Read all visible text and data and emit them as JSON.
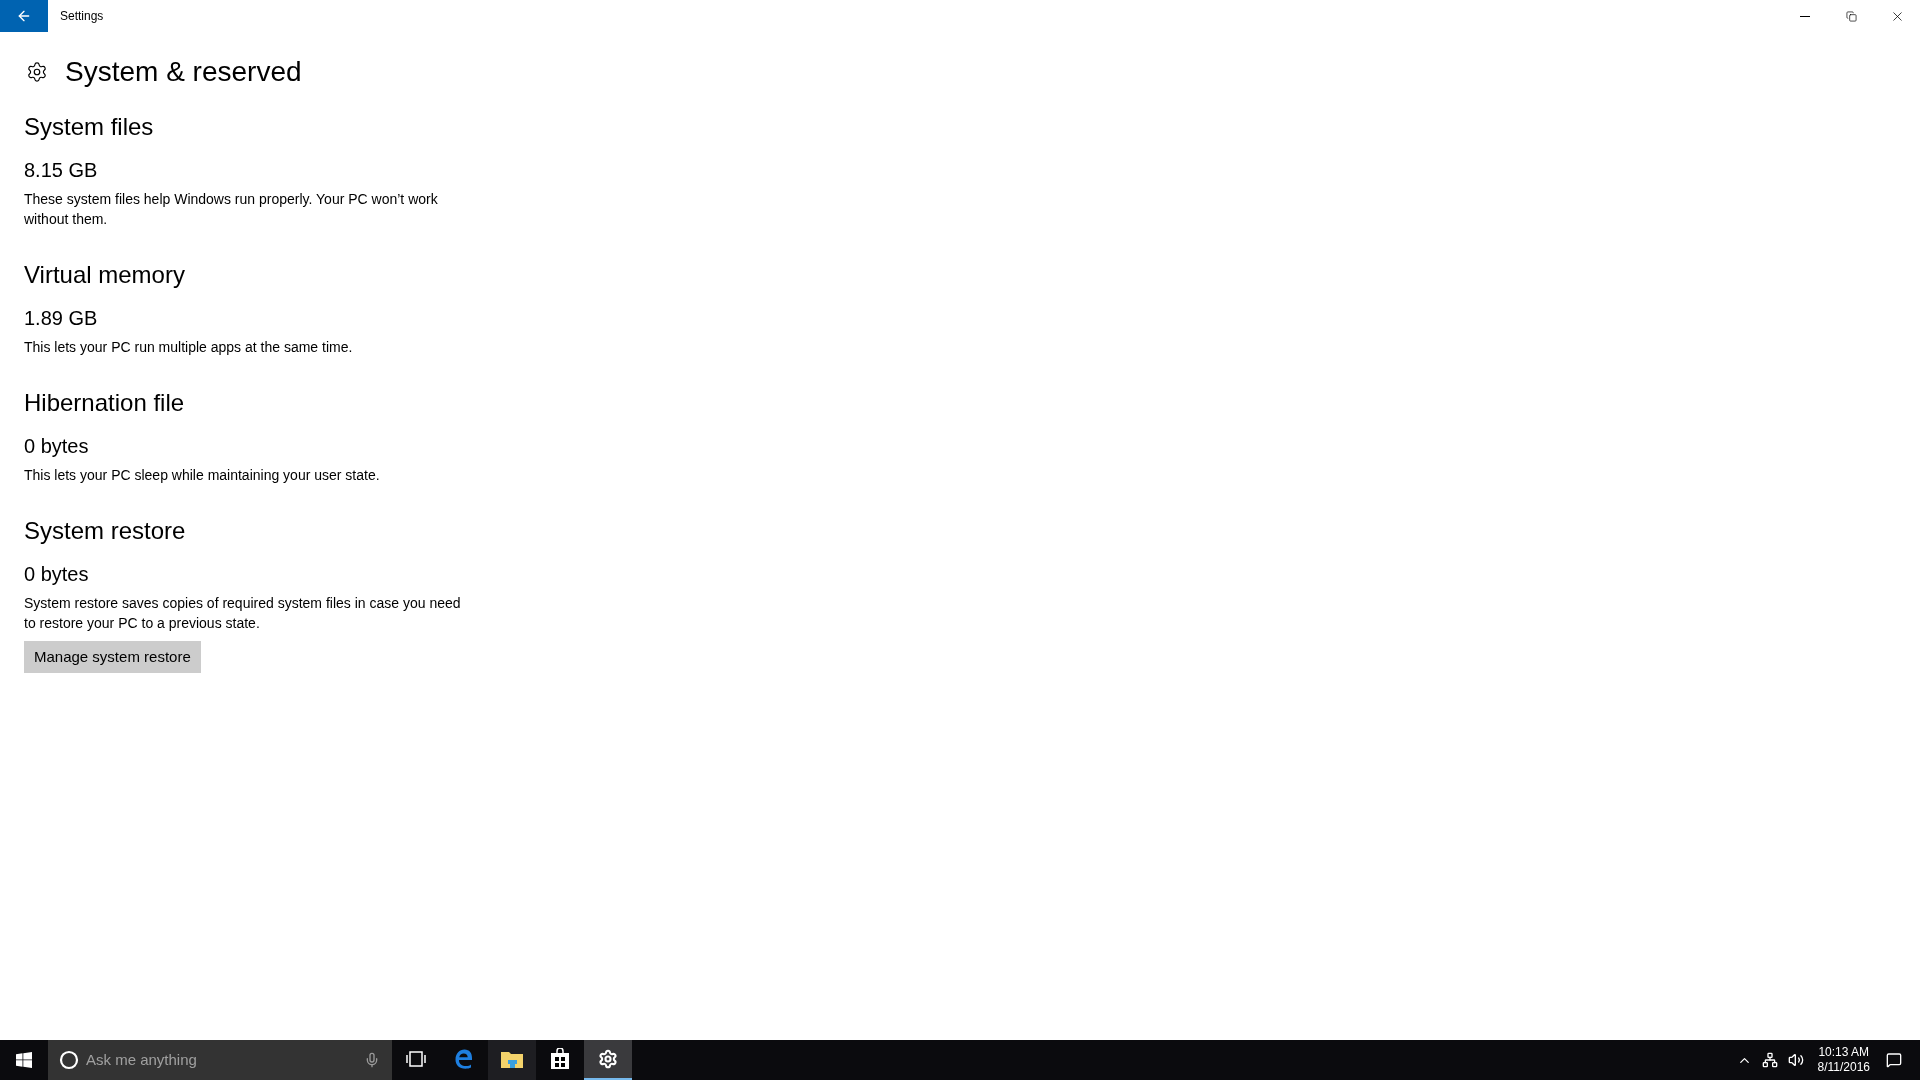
{
  "window": {
    "title": "Settings"
  },
  "page": {
    "title": "System & reserved"
  },
  "sections": [
    {
      "heading": "System files",
      "value": "8.15 GB",
      "description": "These system files help Windows run properly. Your PC won’t work without them."
    },
    {
      "heading": "Virtual memory",
      "value": "1.89 GB",
      "description": "This lets your PC run multiple apps at the same time."
    },
    {
      "heading": "Hibernation file",
      "value": "0 bytes",
      "description": "This lets your PC sleep while maintaining your user state."
    },
    {
      "heading": "System restore",
      "value": "0 bytes",
      "description": "System restore saves copies of required system files in case you need to restore your PC to a previous state.",
      "button": "Manage system restore"
    }
  ],
  "taskbar": {
    "search": {
      "placeholder": "Ask me anything"
    },
    "apps": [
      {
        "kind": "taskview",
        "open": false,
        "selected": false
      },
      {
        "kind": "browser",
        "open": false,
        "selected": false
      },
      {
        "kind": "explorer",
        "open": true,
        "selected": false
      },
      {
        "kind": "store",
        "open": false,
        "selected": false
      },
      {
        "kind": "settings",
        "open": true,
        "selected": true
      }
    ],
    "clock": {
      "time": "10:13 AM",
      "date": "8/11/2016"
    }
  }
}
